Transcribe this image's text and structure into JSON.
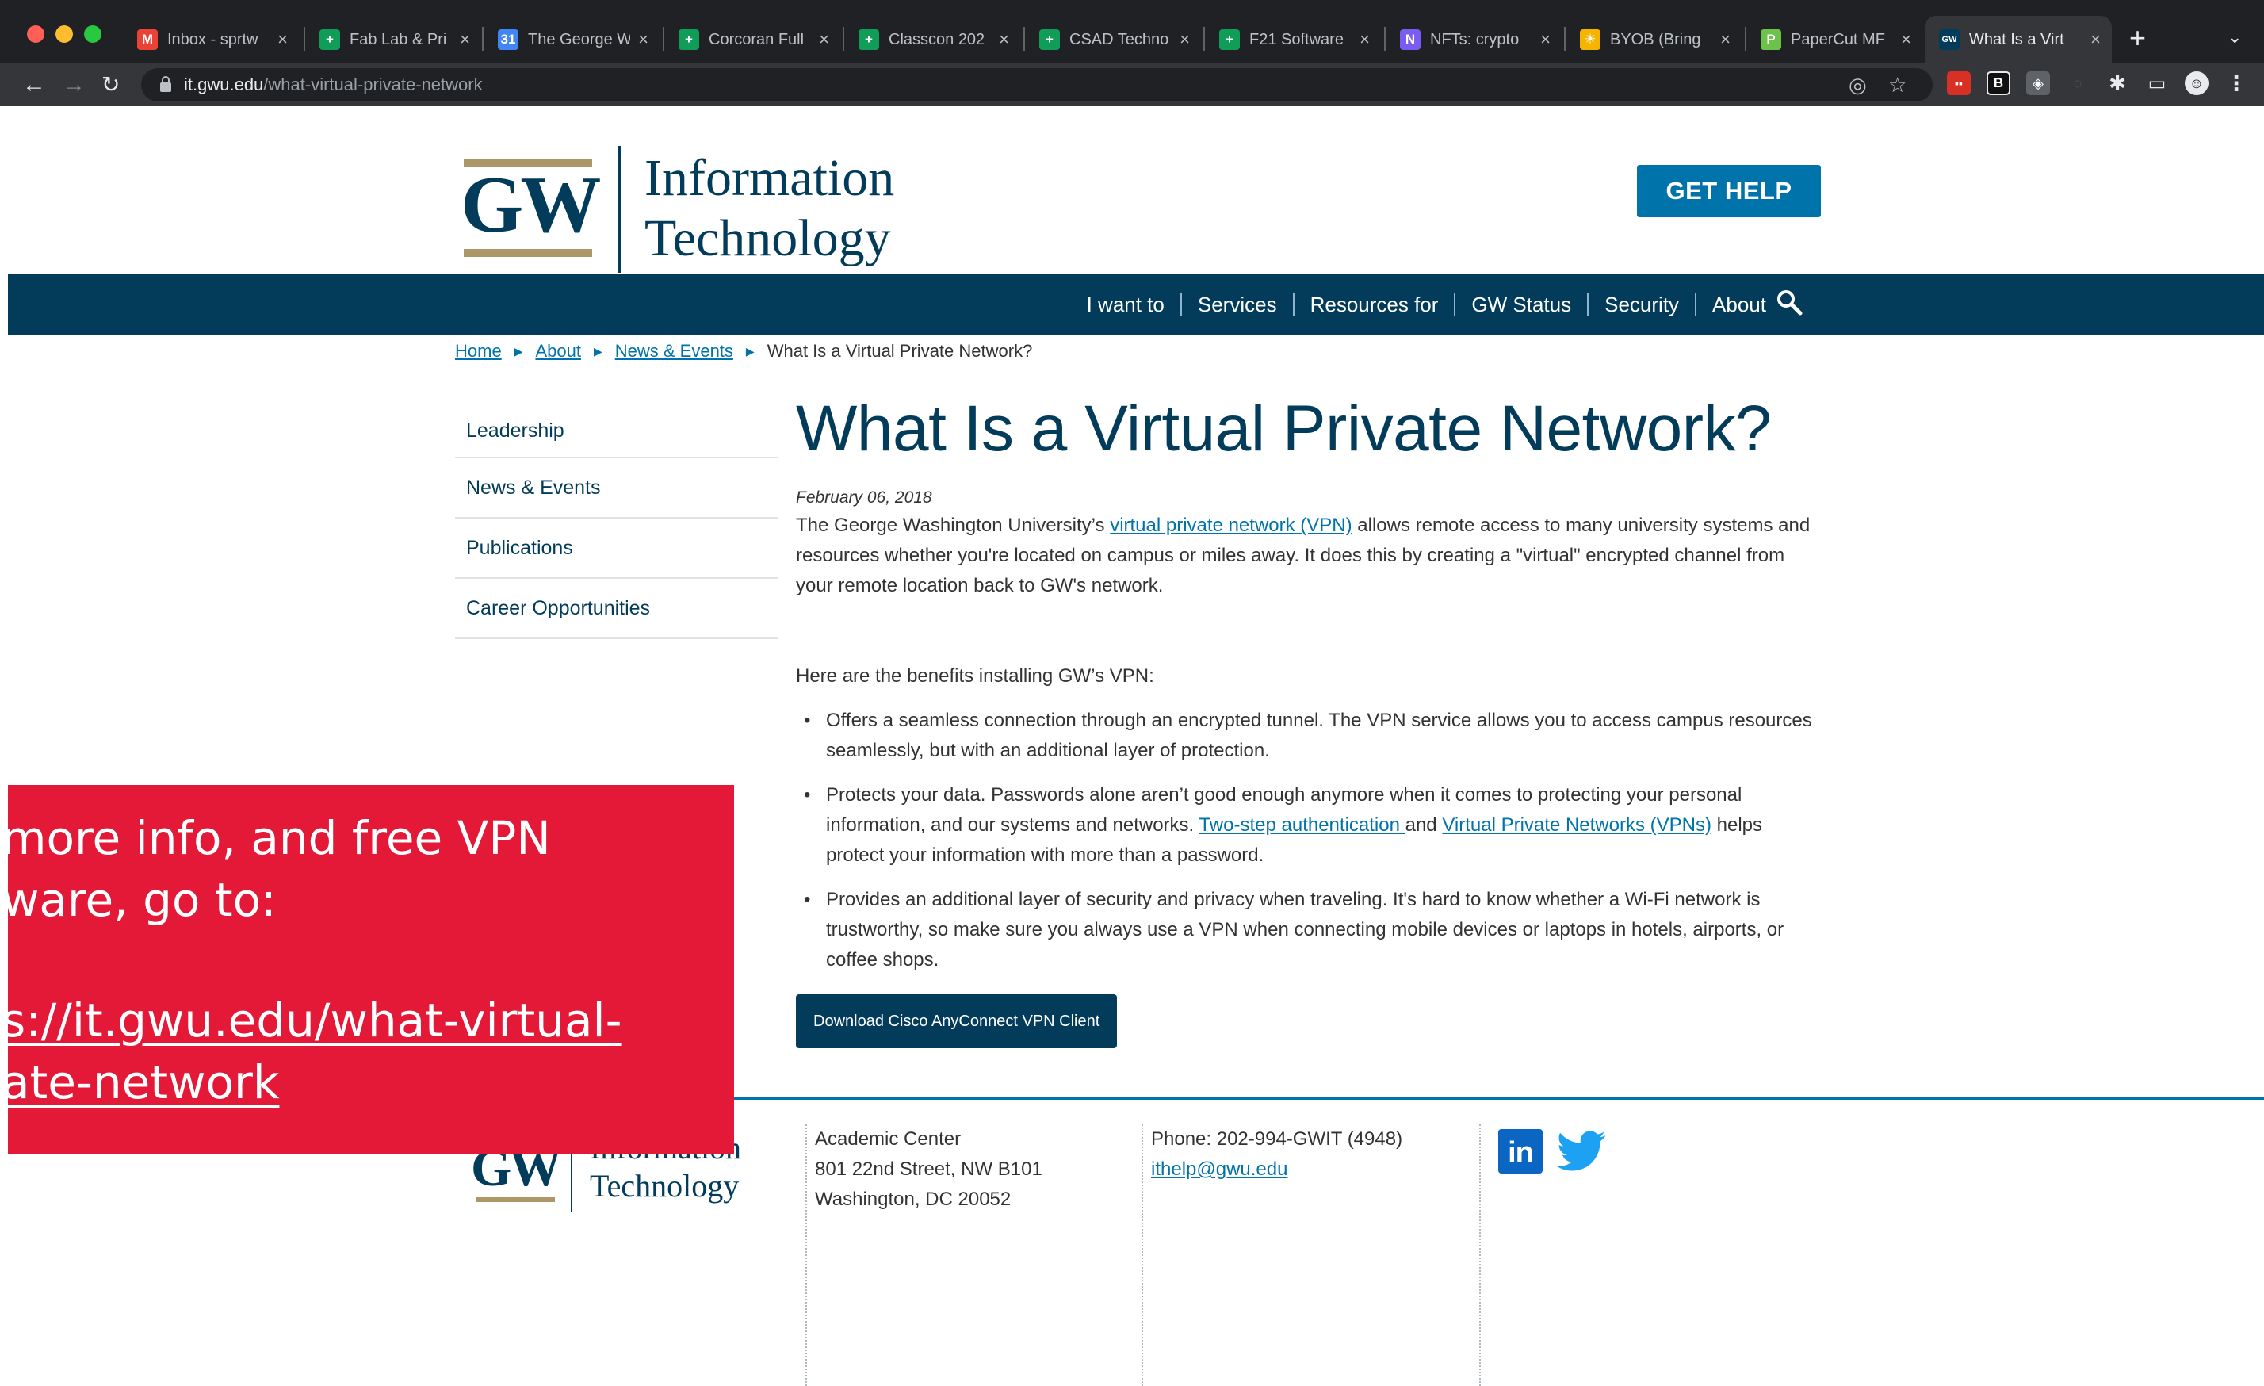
{
  "browser": {
    "tabs": [
      {
        "title": "Inbox - sprtw",
        "icon": "gmail-icon",
        "icon_color": "#ea4335",
        "glyph": "M"
      },
      {
        "title": "Fab Lab & Pri",
        "icon": "sheets-icon",
        "icon_color": "#0f9d58",
        "glyph": "+"
      },
      {
        "title": "The George W",
        "icon": "calendar-icon",
        "icon_color": "#4285f4",
        "glyph": "31"
      },
      {
        "title": "Corcoran Full",
        "icon": "sheets-icon",
        "icon_color": "#0f9d58",
        "glyph": "+"
      },
      {
        "title": "Classcon 202",
        "icon": "sheets-icon",
        "icon_color": "#0f9d58",
        "glyph": "+"
      },
      {
        "title": "CSAD Techno",
        "icon": "sheets-icon",
        "icon_color": "#0f9d58",
        "glyph": "+"
      },
      {
        "title": "F21 Software",
        "icon": "sheets-icon",
        "icon_color": "#0f9d58",
        "glyph": "+"
      },
      {
        "title": "NFTs: crypto",
        "icon": "nft-icon",
        "icon_color": "#7b5cf0",
        "glyph": "N"
      },
      {
        "title": "BYOB (Bring",
        "icon": "lightbulb-icon",
        "icon_color": "#f4b400",
        "glyph": "☀"
      },
      {
        "title": "PaperCut MF",
        "icon": "papercut-icon",
        "icon_color": "#6cc24a",
        "glyph": "P"
      },
      {
        "title": "What Is a Virt",
        "icon": "gw-icon",
        "icon_color": "#033c5a",
        "glyph": "GW",
        "active": true
      }
    ],
    "url_host": "it.gwu.edu",
    "url_path": "/what-virtual-private-network"
  },
  "header": {
    "logo_mark": "GW",
    "logo_line1": "Information",
    "logo_line2": "Technology",
    "get_help": "GET HELP"
  },
  "nav": {
    "items": [
      "I want to",
      "Services",
      "Resources for",
      "GW Status",
      "Security",
      "About"
    ]
  },
  "breadcrumb": {
    "links": [
      "Home",
      "About",
      "News & Events"
    ],
    "current": "What Is a Virtual Private Network?"
  },
  "sidebar": {
    "items": [
      "Leadership",
      "News & Events",
      "Publications",
      "Career Opportunities"
    ]
  },
  "article": {
    "title": "What Is a Virtual Private Network?",
    "date": "February 06, 2018",
    "intro_before": "The George Washington University’s ",
    "intro_link": "virtual private network (VPN)",
    "intro_after": " allows remote access to many university systems and resources whether you're located on campus or miles away. It does this by creating a \"virtual\" encrypted channel from your remote location back to GW's network.",
    "benefits_lead": "Here are the benefits installing GW’s VPN:",
    "benefit1": "Offers a seamless connection through an encrypted tunnel. The VPN service allows you to access campus resources seamlessly, but with an additional layer of protection.",
    "benefit2_before": "Protects your data. Passwords alone aren’t good enough anymore when it comes to protecting your personal information, and our systems and networks. ",
    "benefit2_link1": "Two-step authentication ",
    "benefit2_mid": "and ",
    "benefit2_link2": "Virtual Private Networks (VPNs)",
    "benefit2_after": " helps protect your information with more than a password.",
    "benefit3": "Provides an additional layer of security and privacy when traveling. It's hard to know whether a Wi-Fi network is trustworthy, so make sure you always use a VPN when connecting mobile devices or laptops in hotels, airports, or coffee shops.",
    "download_button": "Download Cisco AnyConnect VPN Client"
  },
  "footer": {
    "logo_mark": "GW",
    "logo_line1": "Information",
    "logo_line2": "Technology",
    "address1": "Academic Center",
    "address2": "801 22nd Street, NW B101",
    "address3": "Washington, DC 20052",
    "phone": "Phone: 202-994-GWIT (4948)",
    "email": "ithelp@gwu.edu"
  },
  "callout": {
    "line1": "more info, and free VPN",
    "line2": "ware, go to:",
    "link1": "s://it.gwu.edu/what-virtual-",
    "link2": "ate-network"
  },
  "colors": {
    "gw_navy": "#033c5a",
    "gw_buff": "#aa9868",
    "link_blue": "#0073aa",
    "callout_red": "#e31937",
    "chrome_dark": "#202124"
  }
}
